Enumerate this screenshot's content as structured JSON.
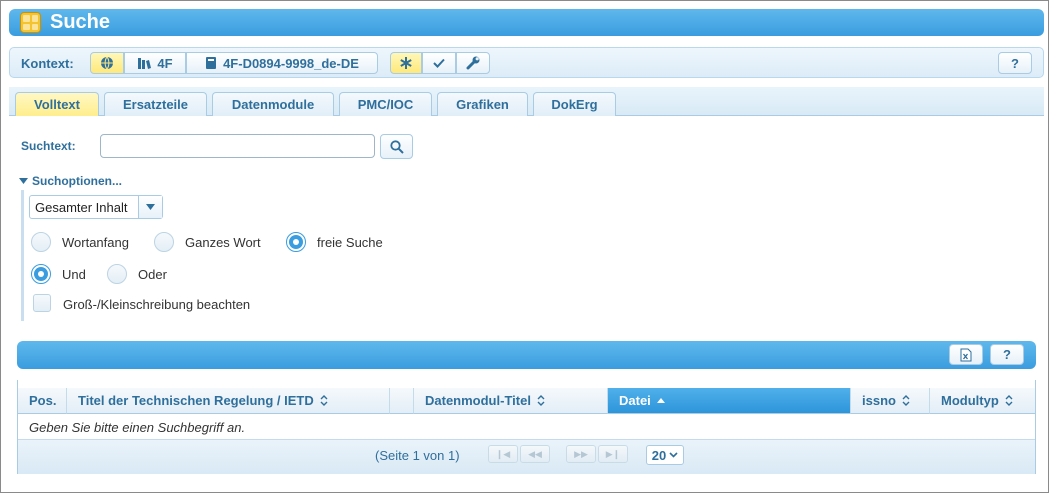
{
  "window": {
    "title": "Suche"
  },
  "context": {
    "label": "Kontext:",
    "model": "4F",
    "document": "4F-D0894-9998_de-DE",
    "help_label": "?"
  },
  "tabs": [
    {
      "label": "Volltext",
      "active": true
    },
    {
      "label": "Ersatzteile"
    },
    {
      "label": "Datenmodule"
    },
    {
      "label": "PMC/IOC"
    },
    {
      "label": "Grafiken"
    },
    {
      "label": "DokErg"
    }
  ],
  "search": {
    "label": "Suchtext:",
    "value": "",
    "placeholder": ""
  },
  "options": {
    "toggle_label": "Suchoptionen...",
    "scope_selected": "Gesamter Inhalt",
    "match_modes": [
      {
        "label": "Wortanfang",
        "selected": false
      },
      {
        "label": "Ganzes Wort",
        "selected": false
      },
      {
        "label": "freie Suche",
        "selected": true
      }
    ],
    "logic_modes": [
      {
        "label": "Und",
        "selected": true
      },
      {
        "label": "Oder",
        "selected": false
      }
    ],
    "case_sensitive_label": "Groß-/Kleinschreibung beachten",
    "case_sensitive": false
  },
  "results": {
    "help_label": "?",
    "columns": [
      {
        "label": "Pos."
      },
      {
        "label": "Titel der Technischen Regelung / IETD"
      },
      {
        "label": ""
      },
      {
        "label": "Datenmodul-Titel"
      },
      {
        "label": "Datei",
        "sorted": "asc"
      },
      {
        "label": "issno"
      },
      {
        "label": "Modultyp"
      }
    ],
    "empty_message": "Geben Sie bitte einen Suchbegriff an.",
    "pager": {
      "info": "(Seite 1 von 1)",
      "page_size": "20"
    }
  },
  "colors": {
    "accent": "#3a9ddf",
    "active_tab": "#ffee8c",
    "label": "#2f6f9c"
  }
}
